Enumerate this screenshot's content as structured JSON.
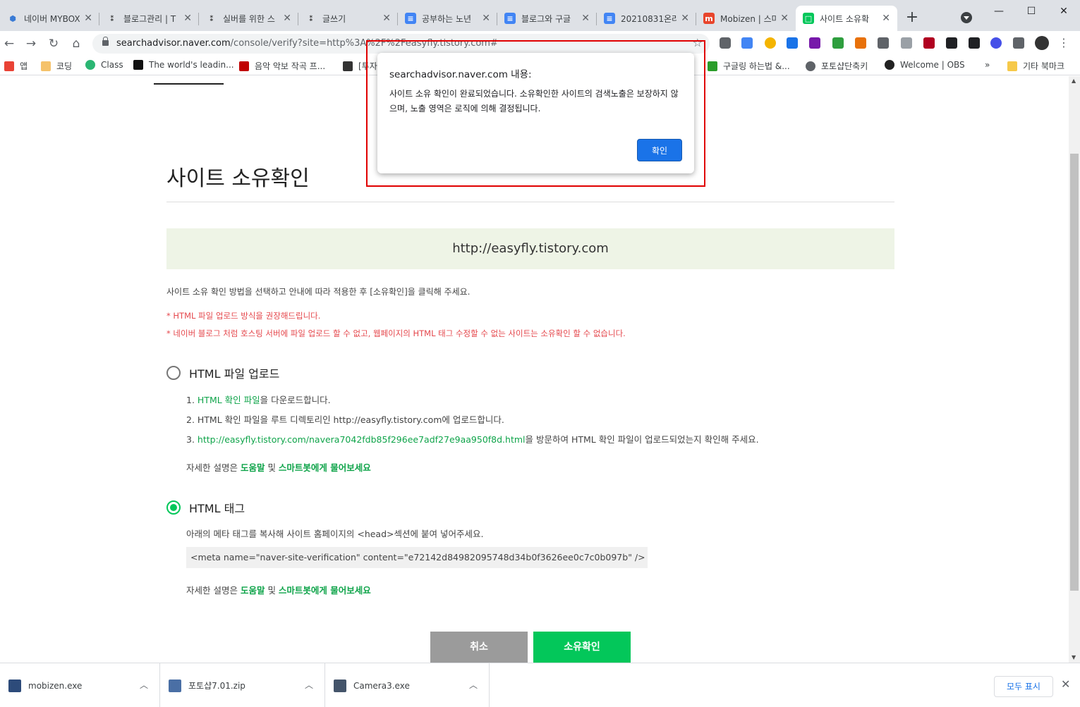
{
  "tabs": [
    {
      "title": "네이버 MYBOX",
      "favicon_color": "#3a7bd5",
      "favicon_char": "⬢"
    },
    {
      "title": "블로그관리 | T",
      "favicon_color": "#333333",
      "favicon_char": "⁑"
    },
    {
      "title": "실버를 위한 스",
      "favicon_color": "#333333",
      "favicon_char": "⁑"
    },
    {
      "title": "글쓰기",
      "favicon_color": "#333333",
      "favicon_char": "⁑"
    },
    {
      "title": "공부하는 노년",
      "favicon_color": "#4285f4",
      "favicon_char": "≡"
    },
    {
      "title": "블로그와 구글",
      "favicon_color": "#4285f4",
      "favicon_char": "≡"
    },
    {
      "title": "20210831온라",
      "favicon_color": "#4285f4",
      "favicon_char": "≡"
    },
    {
      "title": "Mobizen | 스마",
      "favicon_color": "#e8452c",
      "favicon_char": "m"
    },
    {
      "title": "사이트 소유확",
      "favicon_color": "#03c75a",
      "favicon_char": "□"
    }
  ],
  "window": {
    "minimize": "—",
    "maximize": "☐",
    "close": "✕"
  },
  "address": {
    "host": "searchadvisor.naver.com",
    "path": "/console/verify?site=http%3A%2F%2Feasyfly.tistory.com#"
  },
  "bookmarks": [
    {
      "label": "앱",
      "color": "#e94235"
    },
    {
      "label": "코딩",
      "color": "#f5c26b"
    },
    {
      "label": "Class",
      "color": "#2bb673"
    },
    {
      "label": "The world's leadin...",
      "color": "#111111"
    },
    {
      "label": "음악 악보 작곡 프...",
      "color": "#c00000"
    },
    {
      "label": "[투자",
      "color": "#333333"
    },
    {
      "label": "구글링 하는법 &...",
      "color": "#2a9d2a"
    },
    {
      "label": "포토샵단축키",
      "color": "#5f6368"
    },
    {
      "label": "Welcome | OBS",
      "color": "#222222"
    }
  ],
  "bookmarks_more": "»",
  "other_bookmarks": "기타 북마크",
  "page": {
    "title": "사이트 소유확인",
    "site_url": "http://easyfly.tistory.com",
    "intro": "사이트 소유 확인 방법을 선택하고 안내에 따라 적용한 후 [소유확인]을 클릭해 주세요.",
    "warn1": "* HTML 파일 업로드 방식을 권장해드립니다.",
    "warn2": "* 네이버 블로그 처럼 호스팅 서버에 파일 업로드 할 수 없고, 웹페이지의 HTML 태그 수정할 수 없는 사이트는 소유확인 할 수 없습니다.",
    "option1": {
      "label": "HTML 파일 업로드",
      "step1_prefix": "1. ",
      "step1_link": "HTML 확인 파일",
      "step1_suffix": "을 다운로드합니다.",
      "step2": "2. HTML 확인 파일을 루트 디렉토리인 http://easyfly.tistory.com에 업로드합니다.",
      "step3_prefix": "3. ",
      "step3_link": "http://easyfly.tistory.com/navera7042fdb85f296ee7adf27e9aa950f8d.html",
      "step3_suffix": "을 방문하여 HTML 확인 파일이 업로드되었는지 확인해 주세요.",
      "help_prefix": "자세한 설명은 ",
      "help_link1": "도움말",
      "help_mid": " 및 ",
      "help_link2": "스마트봇에게 물어보세요"
    },
    "option2": {
      "label": "HTML 태그",
      "desc": "아래의 메타 태그를 복사해 사이트 홈페이지의 <head>섹션에 붙여 넣어주세요.",
      "meta": "<meta name=\"naver-site-verification\" content=\"e72142d84982095748d34b0f3626ee0c7c0b097b\" />",
      "help_prefix": "자세한 설명은 ",
      "help_link1": "도움말",
      "help_mid": " 및 ",
      "help_link2": "스마트봇에게 물어보세요"
    },
    "cancel": "취소",
    "confirm": "소유확인"
  },
  "dialog": {
    "title": "searchadvisor.naver.com 내용:",
    "message": "사이트 소유 확인이 완료되었습니다. 소유확인한 사이트의 검색노출은 보장하지 않으며, 노출 영역은 로직에 의해 결정됩니다.",
    "ok": "확인"
  },
  "downloads": [
    {
      "name": "mobizen.exe",
      "color": "#2d4b7a"
    },
    {
      "name": "포토샵7.01.zip",
      "color": "#4a6fa5"
    },
    {
      "name": "Camera3.exe",
      "color": "#44546a"
    }
  ],
  "show_all": "모두 표시",
  "colors": {
    "accent_green": "#03c75a",
    "dialog_blue": "#1a73e8",
    "warn_red": "#e5484d",
    "highlight_red": "#e00000"
  }
}
